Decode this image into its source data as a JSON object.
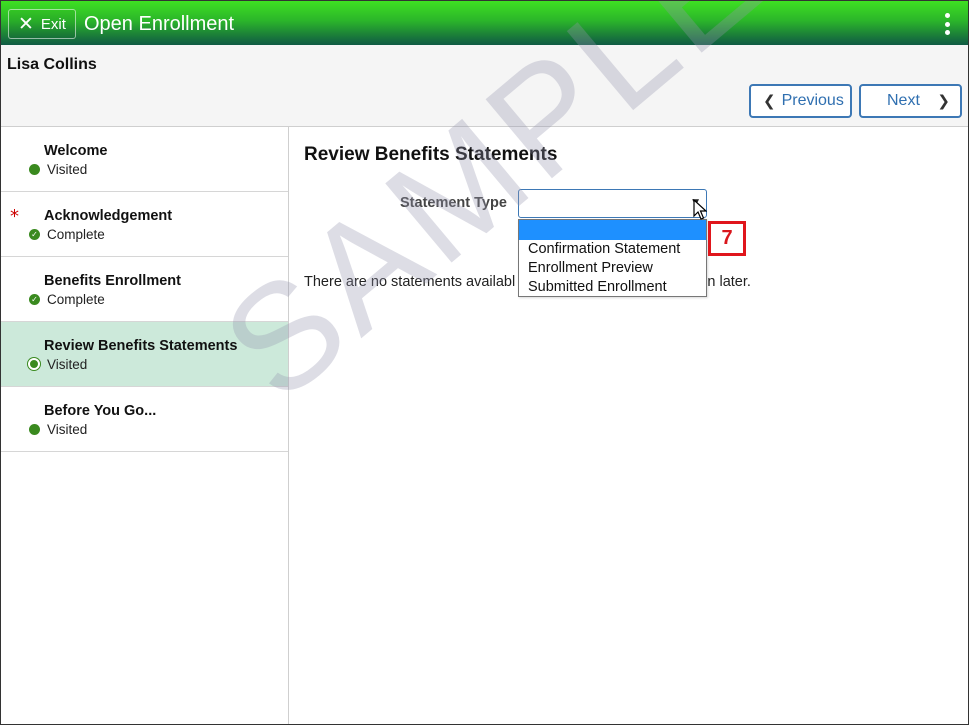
{
  "header": {
    "exit_label": "Exit",
    "title": "Open Enrollment"
  },
  "subheader": {
    "person_name": "Lisa Collins",
    "previous_label": "Previous",
    "next_label": "Next"
  },
  "sidebar": {
    "steps": [
      {
        "title": "Welcome",
        "status": "Visited",
        "status_icon": "visited-dot-icon",
        "required": false
      },
      {
        "title": "Acknowledgement",
        "status": "Complete",
        "status_icon": "complete-check-icon",
        "required": true,
        "required_mark": "*"
      },
      {
        "title": "Benefits Enrollment",
        "status": "Complete",
        "status_icon": "complete-check-icon",
        "required": false
      },
      {
        "title": "Review Benefits Statements",
        "status": "Visited",
        "status_icon": "visited-dot-icon",
        "required": false,
        "active": true
      },
      {
        "title": "Before You Go...",
        "status": "Visited",
        "status_icon": "visited-dot-icon",
        "required": false
      }
    ]
  },
  "main": {
    "title": "Review Benefits Statements",
    "statement_type_label": "Statement Type",
    "statement_type_value": "",
    "statement_type_options": [
      "",
      "Confirmation Statement",
      "Enrollment Preview",
      "Submitted Enrollment"
    ],
    "message": "There are no statements available at this time. Please check back again later.",
    "message_visible_prefix": "There are no statements availabl",
    "message_visible_suffix": "in later."
  },
  "callout_number": "7",
  "watermark": "SAMPLE",
  "colors": {
    "header_green": "#2bb52a",
    "active_step_bg": "#cce9da",
    "button_blue": "#3d78b5",
    "selected_option": "#1e90ff",
    "callout_red": "#e0161c",
    "status_green": "#3a8a1f"
  }
}
